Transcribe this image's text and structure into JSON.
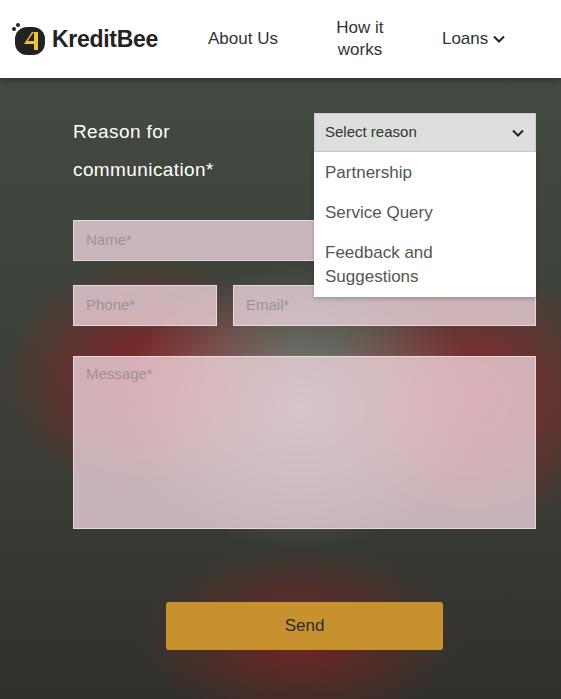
{
  "header": {
    "logo": "KreditBee",
    "nav": [
      {
        "label": "About Us"
      },
      {
        "label": "How it works"
      },
      {
        "label": "Loans",
        "expanded": false
      }
    ]
  },
  "form": {
    "reason_label": "Reason for communication*",
    "reason": {
      "placeholder": "Select reason",
      "expanded": true,
      "options": [
        {
          "label": "Partnership",
          "selected": false
        },
        {
          "label": "Service Query",
          "selected": false
        },
        {
          "label": "Feedback and Suggestions",
          "selected": false
        }
      ]
    },
    "fields": [
      {
        "placeholder": "Name*"
      },
      {
        "placeholder": "Phone*"
      },
      {
        "placeholder": "Email*"
      }
    ],
    "message": {
      "placeholder": "Message*"
    },
    "button": "Send"
  }
}
